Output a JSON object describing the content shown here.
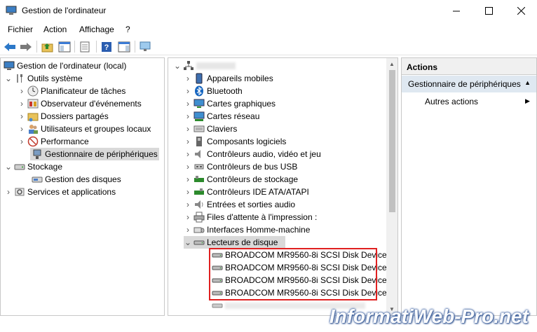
{
  "window": {
    "title": "Gestion de l'ordinateur"
  },
  "menu": [
    "Fichier",
    "Action",
    "Affichage",
    "?"
  ],
  "left_tree": {
    "root": "Gestion de l'ordinateur (local)",
    "system_tools": "Outils système",
    "system_items": [
      "Planificateur de tâches",
      "Observateur d'événements",
      "Dossiers partagés",
      "Utilisateurs et groupes locaux",
      "Performance",
      "Gestionnaire de périphériques"
    ],
    "storage": "Stockage",
    "storage_items": [
      "Gestion des disques"
    ],
    "services": "Services et applications"
  },
  "device_tree": {
    "categories": [
      "Appareils mobiles",
      "Bluetooth",
      "Cartes graphiques",
      "Cartes réseau",
      "Claviers",
      "Composants logiciels",
      "Contrôleurs audio, vidéo et jeu",
      "Contrôleurs de bus USB",
      "Contrôleurs de stockage",
      "Contrôleurs IDE ATA/ATAPI",
      "Entrées et sorties audio",
      "Files d'attente à l'impression :",
      "Interfaces Homme-machine",
      "Lecteurs de disque"
    ],
    "disk_devices": [
      "BROADCOM MR9560-8i SCSI Disk Device",
      "BROADCOM MR9560-8i SCSI Disk Device",
      "BROADCOM MR9560-8i SCSI Disk Device",
      "BROADCOM MR9560-8i SCSI Disk Device"
    ]
  },
  "actions": {
    "header": "Actions",
    "section": "Gestionnaire de périphériques",
    "more": "Autres actions"
  },
  "watermark": "InformatiWeb-Pro.net",
  "colors": {
    "highlight_box": "#e02020",
    "selection": "#d9d9d9",
    "action_section": "#dfe8f1"
  }
}
